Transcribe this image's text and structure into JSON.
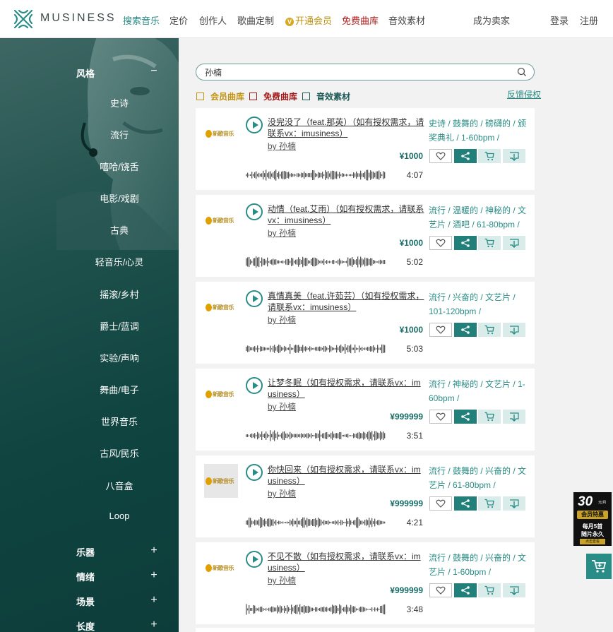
{
  "header": {
    "brand": "MUSINESS",
    "nav": [
      "搜索音乐",
      "定价",
      "创作人",
      "歌曲定制",
      "开通会员",
      "免费曲库",
      "音效素材"
    ],
    "vip_badge": "V",
    "seller": "成为卖家",
    "login": "登录",
    "register": "注册",
    "colors": {
      "accent": "#2a8c86",
      "gold": "#c09412",
      "red": "#b31d1d"
    }
  },
  "sidebar": {
    "style_head": "风格",
    "style_sign": "−",
    "styles": [
      "史诗",
      "流行",
      "嘻哈/饶舌",
      "电影/戏剧",
      "古典",
      "轻音乐/心灵",
      "摇滚/乡村",
      "爵士/蓝调",
      "实验/声响",
      "舞曲/电子",
      "世界音乐",
      "古风/民乐",
      "八音盒",
      "Loop"
    ],
    "sections": [
      {
        "label": "乐器",
        "sign": "+"
      },
      {
        "label": "情绪",
        "sign": "+"
      },
      {
        "label": "场景",
        "sign": "+"
      },
      {
        "label": "长度",
        "sign": "+"
      }
    ]
  },
  "search": {
    "value": "孙楠",
    "icon": "search-icon"
  },
  "filters": [
    {
      "label": "会员曲库",
      "color": "#c09412"
    },
    {
      "label": "免费曲库",
      "color": "#a01818"
    },
    {
      "label": "音效素材",
      "color": "#1d5a55"
    }
  ],
  "feedback": "反馈侵权",
  "thumb_logo_text": "新歌音乐",
  "tracks": [
    {
      "title": "没完没了（feat.那英）（如有授权需求，请联系vx：imusiness）",
      "by": "by 孙楠",
      "price": "¥1000",
      "duration": "4:07",
      "tags": "史诗 / 鼓舞的 / 磅礴的 / 颁奖典礼 / 1-60bpm /",
      "thumb_gray": false
    },
    {
      "title": "动情（feat.艾雨）（如有授权需求，请联系vx：imusiness）",
      "by": "by 孙楠",
      "price": "¥1000",
      "duration": "5:02",
      "tags": "流行 / 温暖的 / 神秘的 / 文艺片 / 酒吧 / 61-80bpm /",
      "thumb_gray": false
    },
    {
      "title": "真情真美（feat.许茹芸）（如有授权需求，请联系vx：imusiness）",
      "by": "by 孙楠",
      "price": "¥1000",
      "duration": "5:03",
      "tags": "流行 / 兴奋的 / 文艺片 / 101-120bpm /",
      "thumb_gray": false
    },
    {
      "title": "让梦冬眠（如有授权需求，请联系vx：imusiness）",
      "by": "by 孙楠",
      "price": "¥999999",
      "duration": "3:51",
      "tags": "流行 / 神秘的 / 文艺片 / 1-60bpm /",
      "thumb_gray": false
    },
    {
      "title": "你快回来（如有授权需求，请联系vx：imusiness）",
      "by": "by 孙楠",
      "price": "¥999999",
      "duration": "4:21",
      "tags": "流行 / 鼓舞的 / 兴奋的 / 文艺片 / 61-80bpm /",
      "thumb_gray": true
    },
    {
      "title": "不见不散（如有授权需求，请联系vx：imusiness）",
      "by": "by 孙楠",
      "price": "¥999999",
      "duration": "3:48",
      "tags": "流行 / 鼓舞的 / 兴奋的 / 文艺片 / 1-60bpm /",
      "thumb_gray": false
    }
  ],
  "promo": {
    "number": "30",
    "unit": "元/月",
    "line1": "会员特惠",
    "line2": "每月5首",
    "line3": "随片永久",
    "button": "点击查看"
  },
  "cart_icon": "cart-icon"
}
